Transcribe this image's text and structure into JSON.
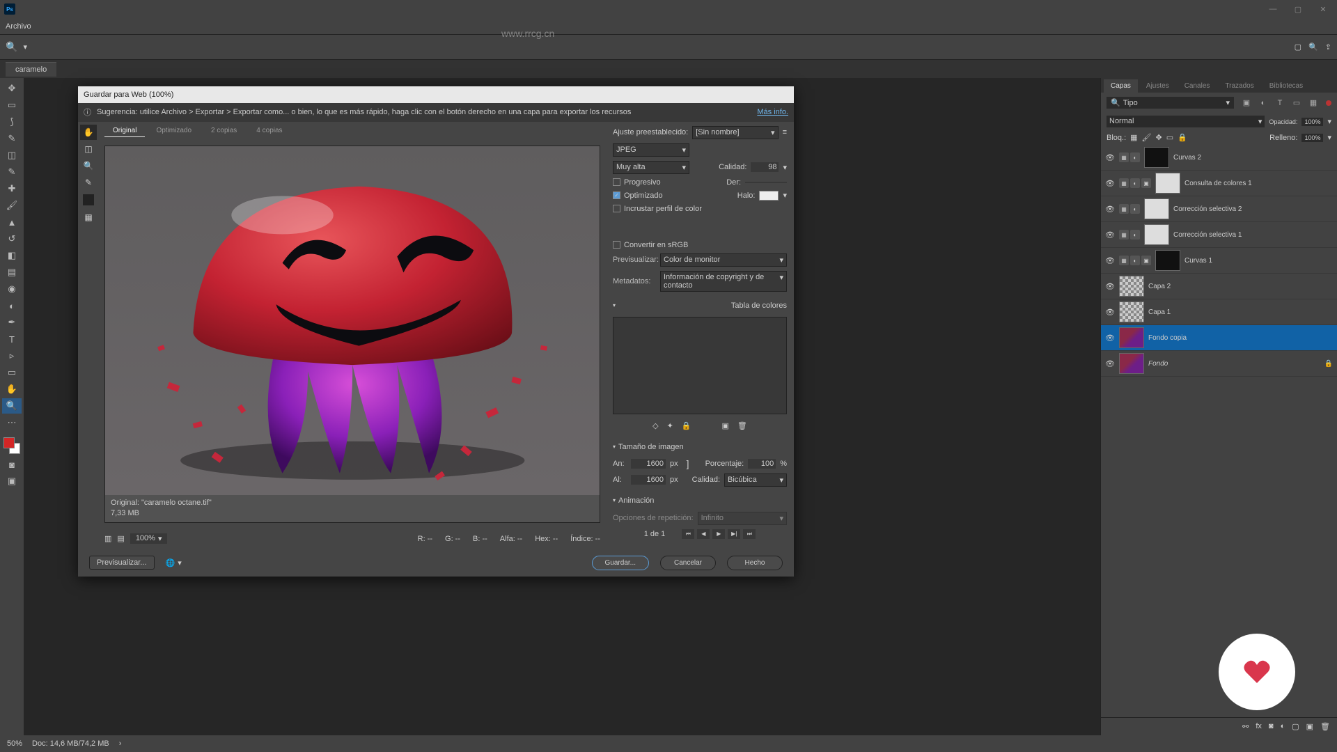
{
  "app": {
    "menu_archivo": "Archivo",
    "url_watermark": "www.rrcg.cn"
  },
  "doc": {
    "tab": "caramelo",
    "zoom": "50%",
    "docinfo": "Doc: 14,6 MB/74,2 MB"
  },
  "dialog": {
    "title": "Guardar para Web (100%)",
    "hint": "Sugerencia: utilice Archivo > Exportar > Exportar como... o bien, lo que es más rápido, haga clic con el botón derecho en una capa para exportar los recursos",
    "more": "Más info.",
    "tabs": {
      "orig": "Original",
      "opt": "Optimizado",
      "dos": "2 copias",
      "cuatro": "4 copias"
    },
    "info_name": "Original: \"caramelo octane.tif\"",
    "info_size": "7,33 MB",
    "preset_lbl": "Ajuste preestablecido:",
    "preset_val": "[Sin nombre]",
    "format": "JPEG",
    "quality_preset": "Muy alta",
    "quality_lbl": "Calidad:",
    "quality_val": "98",
    "progresivo": "Progresivo",
    "der": "Der:",
    "optimizado": "Optimizado",
    "halo": "Halo:",
    "incrustar": "Incrustar perfil de color",
    "convert": "Convertir en sRGB",
    "prev_lbl": "Previsualizar:",
    "prev_val": "Color de monitor",
    "meta_lbl": "Metadatos:",
    "meta_val": "Información de copyright y de contacto",
    "color_table": "Tabla de colores",
    "img_size": "Tamaño de imagen",
    "an": "An:",
    "al": "Al:",
    "px": "px",
    "w": "1600",
    "h": "1600",
    "pct_lbl": "Porcentaje:",
    "pct": "100",
    "pct_sym": "%",
    "qual2": "Calidad:",
    "qual2_val": "Bicúbica",
    "anim": "Animación",
    "rep_lbl": "Opciones de repetición:",
    "rep_val": "Infinito",
    "frame": "1 de 1",
    "zoom": "100%",
    "r": "R: --",
    "g": "G: --",
    "b": "B: --",
    "alfa": "Alfa: --",
    "hex": "Hex: --",
    "indice": "Índice: --",
    "previsualizar": "Previsualizar...",
    "guardar": "Guardar...",
    "cancelar": "Cancelar",
    "hecho": "Hecho"
  },
  "panels": {
    "tabs": {
      "capas": "Capas",
      "ajustes": "Ajustes",
      "canales": "Canales",
      "trazados": "Trazados",
      "bibliotecas": "Bibliotecas"
    },
    "filter": "Tipo",
    "blend": "Normal",
    "opacidad_lbl": "Opacidad:",
    "opacidad": "100%",
    "bloq": "Bloq.:",
    "relleno_lbl": "Relleno:",
    "relleno": "100%",
    "layers": [
      {
        "name": "Curvas 2",
        "adj": true,
        "mask": "black"
      },
      {
        "name": "Consulta de colores 1",
        "adj": true,
        "mask": "white",
        "extra": true
      },
      {
        "name": "Corrección selectiva 2",
        "adj": true,
        "mask": "white"
      },
      {
        "name": "Corrección selectiva 1",
        "adj": true,
        "mask": "white"
      },
      {
        "name": "Curvas 1",
        "adj": true,
        "mask": "black",
        "extra": true
      },
      {
        "name": "Capa 2",
        "chk": true
      },
      {
        "name": "Capa 1",
        "chk": true
      },
      {
        "name": "Fondo copia",
        "img": true,
        "sel": true
      },
      {
        "name": "Fondo",
        "img": true,
        "italic": true,
        "locked": true
      }
    ]
  }
}
